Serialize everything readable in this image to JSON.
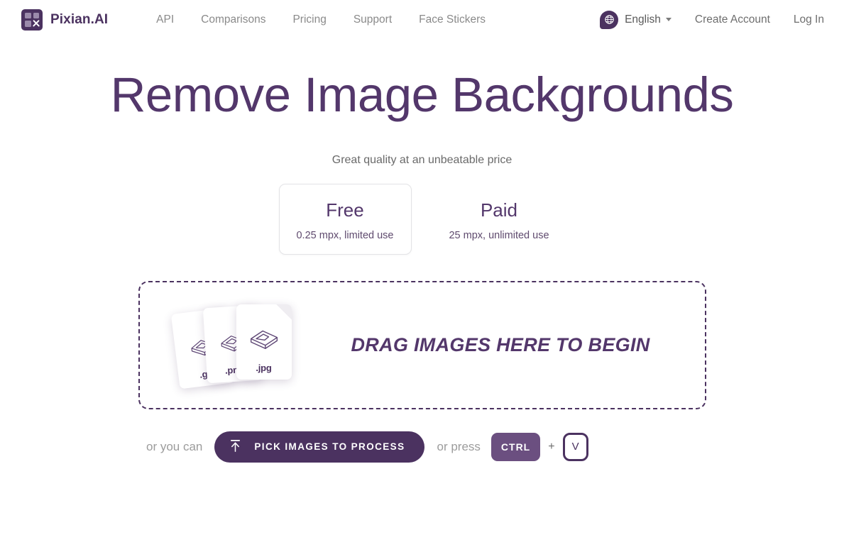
{
  "header": {
    "brand": "Pixian.AI",
    "logo_icon": "pixian-logo-icon",
    "nav": [
      {
        "label": "API"
      },
      {
        "label": "Comparisons"
      },
      {
        "label": "Pricing"
      },
      {
        "label": "Support"
      },
      {
        "label": "Face Stickers"
      }
    ],
    "language": {
      "icon": "globe-icon",
      "label": "English",
      "caret_icon": "chevron-down-icon"
    },
    "create_account": "Create Account",
    "log_in": "Log In"
  },
  "hero": {
    "title": "Remove Image Backgrounds",
    "subtitle": "Great quality at an unbeatable price"
  },
  "plans": [
    {
      "name": "Free",
      "detail": "0.25 mpx, limited use",
      "selected": true
    },
    {
      "name": "Paid",
      "detail": "25 mpx, unlimited use",
      "selected": false
    }
  ],
  "dropzone": {
    "message": "DRAG IMAGES HERE TO BEGIN",
    "files": [
      {
        "ext": ".gif",
        "icon": "image-file-icon"
      },
      {
        "ext": ".png",
        "icon": "image-file-icon"
      },
      {
        "ext": ".jpg",
        "icon": "image-file-icon"
      }
    ]
  },
  "actions": {
    "prefix": "or you can",
    "pick_button": "PICK IMAGES TO PROCESS",
    "pick_icon": "upload-icon",
    "middle": "or press",
    "key_modifier": "CTRL",
    "key_plus": "+",
    "key_letter": "V"
  },
  "colors": {
    "brand_purple": "#4b3260",
    "heading_purple": "#53376b",
    "key_purple": "#6b4f80",
    "muted_gray": "#8a8a8a"
  }
}
